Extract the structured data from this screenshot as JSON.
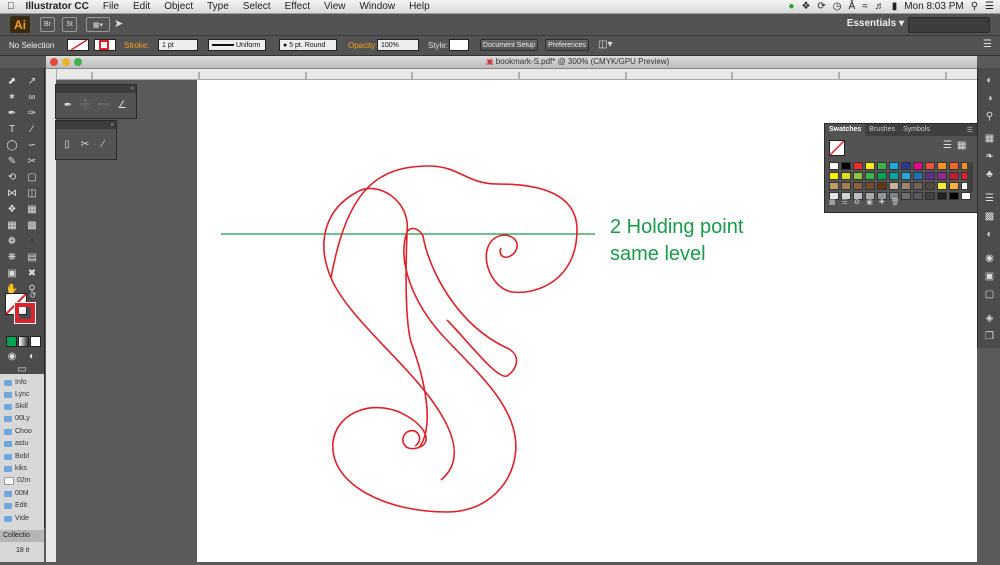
{
  "menubar": {
    "apple": "",
    "app_name": "Illustrator CC",
    "items": [
      "File",
      "Edit",
      "Object",
      "Type",
      "Select",
      "Effect",
      "View",
      "Window",
      "Help"
    ],
    "clock": "Mon 8:03 PM"
  },
  "appbar": {
    "logo": "Ai",
    "bridge": "Br",
    "stock": "St",
    "workspace": "Essentials"
  },
  "control": {
    "selection": "No Selection",
    "stroke_label": "Stroke:",
    "stroke_value": "1 pt",
    "profile": "Uniform",
    "brush": "5 pt. Round",
    "opacity_label": "Opacity:",
    "opacity_value": "100%",
    "style_label": "Style:",
    "doc_setup": "Document Setup",
    "preferences": "Preferences"
  },
  "document": {
    "title": "bookmark-S.pdf* @ 300% (CMYK/GPU Preview)"
  },
  "swatches_panel": {
    "tabs": [
      "Swatches",
      "Brushes",
      "Symbols"
    ],
    "colors": [
      "#ffffff",
      "#000000",
      "#ee2a24",
      "#f6ea18",
      "#37b34a",
      "#1ca9e0",
      "#2b3990",
      "#ec008c",
      "#f04e3c",
      "#f7941d",
      "#f26522",
      "#f7941d",
      "#fff200",
      "#d7df23",
      "#8dc63f",
      "#39b54a",
      "#00a651",
      "#00a99d",
      "#27aae1",
      "#1c75bc",
      "#662d91",
      "#92278f",
      "#be1e2d",
      "#ed1c24",
      "#c49a6c",
      "#a67c52",
      "#8b5e3c",
      "#754c29",
      "#603913",
      "#c7b299",
      "#998675",
      "#736357",
      "#534741",
      "#f9ed32",
      "#fbb040",
      "#ffffff",
      "#e6e7e8",
      "#d1d3d4",
      "#bcbec0",
      "#a7a9ac",
      "#939598",
      "#808285",
      "#6d6e71",
      "#58595b",
      "#414042",
      "#231f20",
      "#000000",
      "#ffffff"
    ]
  },
  "folders": [
    "Info",
    "Lync",
    "Skill",
    "00Ly",
    "Choo",
    "astu",
    "Bobl",
    "kiks",
    "02m",
    "00M",
    "Edit",
    "Vide"
  ],
  "collection": {
    "label": "Collectio",
    "count": "18 it"
  },
  "annotation": {
    "line1": "2 Holding point",
    "line2": "same level",
    "color": "#1a9a4a"
  },
  "artwork": {
    "stroke_color": "#e0202a"
  }
}
